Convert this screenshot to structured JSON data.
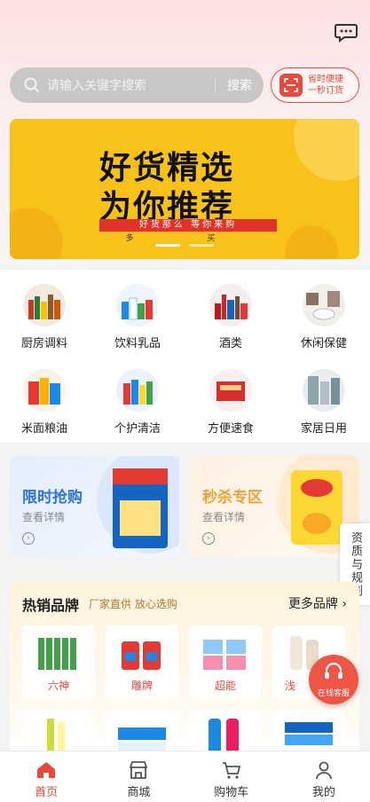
{
  "header": {
    "search_placeholder": "请输入关键字搜索",
    "search_button": "搜索",
    "quick_order_line1": "省时便捷",
    "quick_order_line2": "一秒订货",
    "message_icon": "chat-bubble-icon"
  },
  "banner": {
    "line1": "好货精选",
    "line2": "为你推荐",
    "strip": "好货那么 等你来购",
    "strip2": "多 买",
    "page_count": 2,
    "active_page": 1
  },
  "categories": [
    {
      "label": "厨房调料"
    },
    {
      "label": "饮料乳品"
    },
    {
      "label": "酒类"
    },
    {
      "label": "休闲保健"
    },
    {
      "label": "米面粮油"
    },
    {
      "label": "个护清洁"
    },
    {
      "label": "方便速食"
    },
    {
      "label": "家居日用"
    }
  ],
  "promos": {
    "flash": {
      "title": "限时抢购",
      "sub": "查看详情",
      "color": "#2b74e0"
    },
    "seckill": {
      "title": "秒杀专区",
      "sub": "查看详情",
      "color": "#e8a33a"
    }
  },
  "side_tab": "资质与规则",
  "brands": {
    "title": "热销品牌",
    "subtitle": "厂家直供 放心选购",
    "more": "更多品牌",
    "items": [
      {
        "label": "六神"
      },
      {
        "label": "雕牌"
      },
      {
        "label": "超能"
      },
      {
        "label": "浅"
      }
    ]
  },
  "service_button": "在线客服",
  "tabbar": [
    {
      "label": "首页",
      "icon": "home-icon",
      "active": true
    },
    {
      "label": "商城",
      "icon": "store-icon",
      "active": false
    },
    {
      "label": "购物车",
      "icon": "cart-icon",
      "active": false
    },
    {
      "label": "我的",
      "icon": "user-icon",
      "active": false
    }
  ],
  "colors": {
    "accent": "#e84a3c",
    "banner": "#f8c21a"
  }
}
